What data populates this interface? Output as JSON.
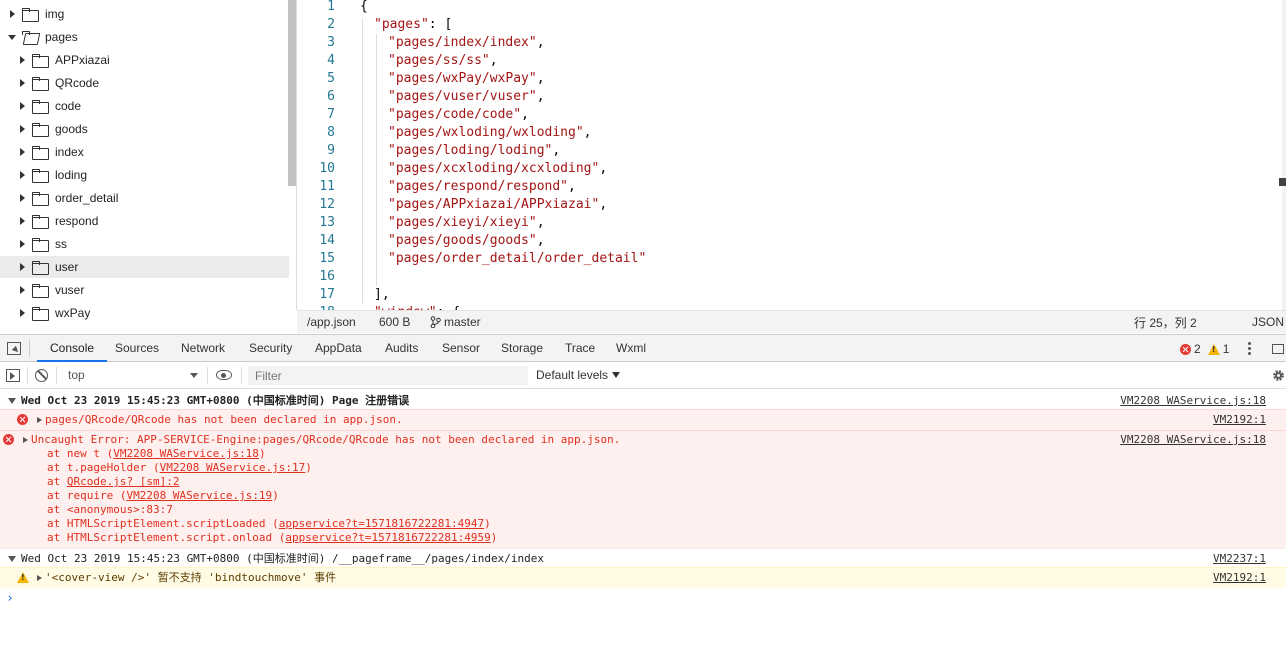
{
  "file_tree": {
    "items": [
      {
        "label": "img",
        "expanded": false,
        "indent": 0,
        "selected": false
      },
      {
        "label": "pages",
        "expanded": true,
        "indent": 0,
        "selected": false
      },
      {
        "label": "APPxiazai",
        "expanded": false,
        "indent": 1,
        "selected": false
      },
      {
        "label": "QRcode",
        "expanded": false,
        "indent": 1,
        "selected": false
      },
      {
        "label": "code",
        "expanded": false,
        "indent": 1,
        "selected": false
      },
      {
        "label": "goods",
        "expanded": false,
        "indent": 1,
        "selected": false
      },
      {
        "label": "index",
        "expanded": false,
        "indent": 1,
        "selected": false
      },
      {
        "label": "loding",
        "expanded": false,
        "indent": 1,
        "selected": false
      },
      {
        "label": "order_detail",
        "expanded": false,
        "indent": 1,
        "selected": false
      },
      {
        "label": "respond",
        "expanded": false,
        "indent": 1,
        "selected": false
      },
      {
        "label": "ss",
        "expanded": false,
        "indent": 1,
        "selected": false
      },
      {
        "label": "user",
        "expanded": false,
        "indent": 1,
        "selected": true
      },
      {
        "label": "vuser",
        "expanded": false,
        "indent": 1,
        "selected": false
      },
      {
        "label": "wxPay",
        "expanded": false,
        "indent": 1,
        "selected": false
      }
    ]
  },
  "editor": {
    "lines": [
      {
        "n": "1",
        "text": "{",
        "indent": 0
      },
      {
        "n": "2",
        "text": "\"pages\": [",
        "indent": 1
      },
      {
        "n": "3",
        "text": "\"pages/index/index\",",
        "indent": 2
      },
      {
        "n": "4",
        "text": "\"pages/ss/ss\",",
        "indent": 2
      },
      {
        "n": "5",
        "text": "\"pages/wxPay/wxPay\",",
        "indent": 2
      },
      {
        "n": "6",
        "text": "\"pages/vuser/vuser\",",
        "indent": 2
      },
      {
        "n": "7",
        "text": "\"pages/code/code\",",
        "indent": 2
      },
      {
        "n": "8",
        "text": "\"pages/wxloding/wxloding\",",
        "indent": 2
      },
      {
        "n": "9",
        "text": "\"pages/loding/loding\",",
        "indent": 2
      },
      {
        "n": "10",
        "text": "\"pages/xcxloding/xcxloding\",",
        "indent": 2
      },
      {
        "n": "11",
        "text": "\"pages/respond/respond\",",
        "indent": 2
      },
      {
        "n": "12",
        "text": "\"pages/APPxiazai/APPxiazai\",",
        "indent": 2
      },
      {
        "n": "13",
        "text": "\"pages/xieyi/xieyi\",",
        "indent": 2
      },
      {
        "n": "14",
        "text": "\"pages/goods/goods\",",
        "indent": 2
      },
      {
        "n": "15",
        "text": "\"pages/order_detail/order_detail\"",
        "indent": 2
      },
      {
        "n": "16",
        "text": "",
        "indent": 2
      },
      {
        "n": "17",
        "text": "],",
        "indent": 1
      },
      {
        "n": "18",
        "text": "\"window\": {",
        "indent": 1
      }
    ]
  },
  "statusbar": {
    "file": "/app.json",
    "size": "600 B",
    "branch": "master",
    "position": "行 25，列 2",
    "language": "JSON"
  },
  "devtools": {
    "tabs": [
      "Console",
      "Sources",
      "Network",
      "Security",
      "AppData",
      "Audits",
      "Sensor",
      "Storage",
      "Trace",
      "Wxml"
    ],
    "active_tab": "Console",
    "error_count": "2",
    "warning_count": "1"
  },
  "console_toolbar": {
    "context": "top",
    "filter_placeholder": "Filter",
    "levels": "Default levels"
  },
  "console": {
    "group1": {
      "header": "Wed Oct 23 2019 15:45:23 GMT+0800 (中国标准时间) Page 注册错误",
      "source": "VM2208 WAService.js:18"
    },
    "error1": {
      "text": "pages/QRcode/QRcode has not been declared in app.json.",
      "source": "VM2192:1"
    },
    "error2": {
      "text": "Uncaught Error: APP-SERVICE-Engine:pages/QRcode/QRcode has not been declared in app.json.",
      "source": "VM2208 WAService.js:18",
      "stack": [
        {
          "prefix": "at new t (",
          "link": "VM2208 WAService.js:18",
          "suffix": ")"
        },
        {
          "prefix": "at t.pageHolder (",
          "link": "VM2208 WAService.js:17",
          "suffix": ")"
        },
        {
          "prefix": "at ",
          "link": "QRcode.js? [sm]:2",
          "suffix": ""
        },
        {
          "prefix": "at require (",
          "link": "VM2208 WAService.js:19",
          "suffix": ")"
        },
        {
          "prefix": "at <anonymous>:83:7",
          "link": "",
          "suffix": ""
        },
        {
          "prefix": "at HTMLScriptElement.scriptLoaded (",
          "link": "appservice?t=1571816722281:4947",
          "suffix": ")"
        },
        {
          "prefix": "at HTMLScriptElement.script.onload (",
          "link": "appservice?t=1571816722281:4959",
          "suffix": ")"
        }
      ]
    },
    "group2": {
      "header": "Wed Oct 23 2019 15:45:23 GMT+0800 (中国标准时间) /__pageframe__/pages/index/index",
      "source": "VM2237:1"
    },
    "warning1": {
      "text": "'<cover-view />' 暂不支持 'bindtouchmove' 事件",
      "source": "VM2192:1"
    }
  },
  "colors": {
    "error_red": "#e0301e",
    "warning_yellow": "#f4b400",
    "accent_blue": "#1a73e8",
    "string_red": "#a31515",
    "line_number_teal": "#237893"
  }
}
